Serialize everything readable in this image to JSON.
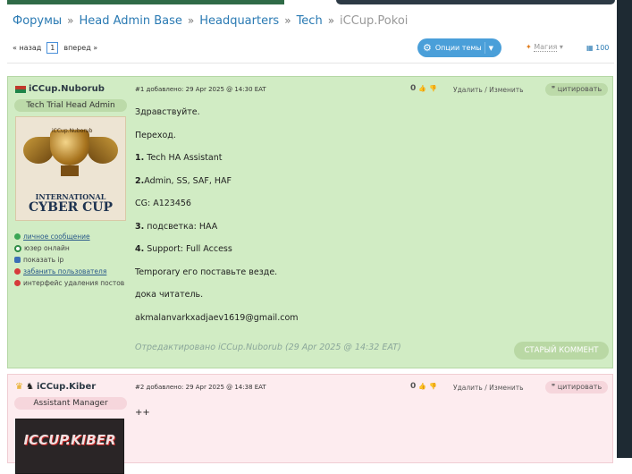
{
  "breadcrumbs": {
    "items": [
      "Форумы",
      "Head Admin Base",
      "Headquarters",
      "Tech"
    ],
    "current": "iCCup.Pokoi",
    "separator": "»"
  },
  "pager": {
    "prev": "« назад",
    "page": "1",
    "next": "вперед »"
  },
  "toolbar": {
    "options_label": "Опции темы",
    "magic_label": "Магия",
    "count": "100"
  },
  "colors": {
    "accent": "#4a9fd9",
    "post_green": "#d1ecc4",
    "post_pink": "#fdecef"
  },
  "posts": [
    {
      "author": "iCCup.Nuborub",
      "rank": "Tech Trial Head Admin",
      "meta": "#1 добавлено: 29 Apr 2025 @ 14:30 EAT",
      "likes": "0",
      "actions": "Удалить / Изменить",
      "quote": "цитировать",
      "avatar": {
        "name": "iCCup.Nuborub",
        "title1": "INTERNATIONAL",
        "title2": "CYBER CUP"
      },
      "user_links": [
        "личное сообщение",
        "юзер онлайн",
        "показать ip",
        "забанить пользователя",
        "интерфейс удаления постов"
      ],
      "body": [
        "Здравствуйте.",
        "Переход.",
        "1. Tech HA Assistant",
        "2.Admin, SS, SAF, HAF",
        "CG: A123456",
        "3. подсветка: HAA",
        "4. Support: Full Access",
        "Temporary его поставьте везде.",
        "дока читатель.",
        "akmalanvarkxadjaev1619@gmail.com"
      ],
      "body_bold_prefix": [
        "",
        "",
        "1.",
        "2.",
        "",
        "3.",
        "4.",
        "",
        "",
        ""
      ],
      "body_rest": [
        "Здравствуйте.",
        "Переход.",
        " Tech HA Assistant",
        "Admin, SS, SAF, HAF",
        "CG: A123456",
        " подсветка: HAA",
        " Support: Full Access",
        "Temporary его поставьте везде.",
        "дока читатель.",
        "akmalanvarkxadjaev1619@gmail.com"
      ],
      "edited": "Отредактировано iCCup.Nuborub (29 Apr 2025 @ 14:32 EAT)",
      "old_comment": "СТАРЫЙ КОММЕНТ"
    },
    {
      "author": "iCCup.Kiber",
      "rank": "Assistant Manager",
      "meta": "#2 добавлено: 29 Apr 2025 @ 14:38 EAT",
      "likes": "0",
      "actions": "Удалить / Изменить",
      "quote": "цитировать",
      "avatar": {
        "name": "ICCUP.KIBER"
      },
      "body": "++"
    }
  ]
}
